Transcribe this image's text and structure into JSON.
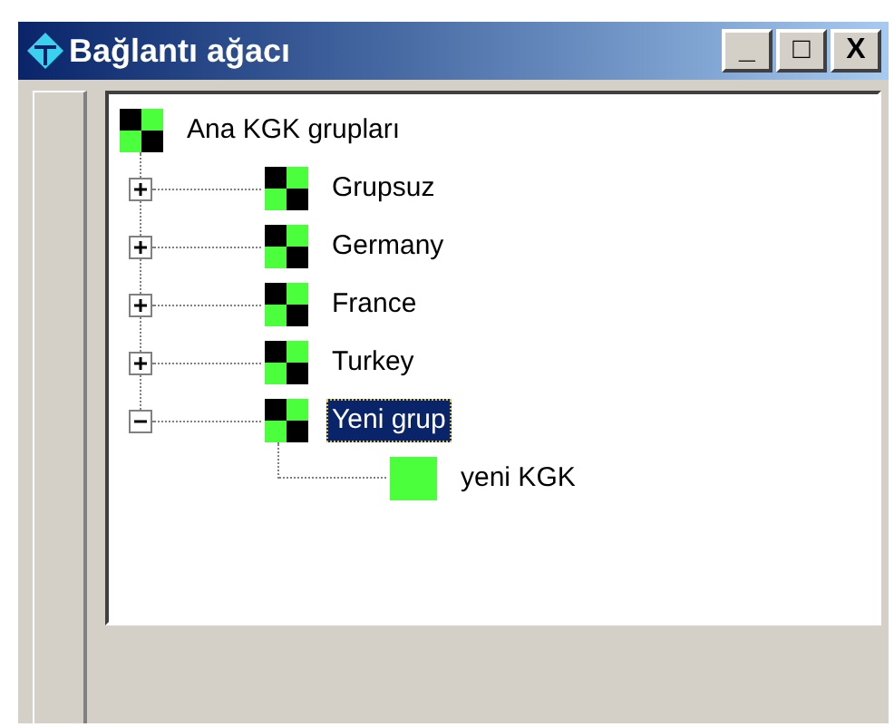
{
  "window": {
    "title": "Bağlantı ağacı",
    "buttons": [
      "_",
      "□",
      "X"
    ]
  },
  "tree": {
    "label": "Ana KGK grupları",
    "kind": "group",
    "selected": false,
    "children": [
      {
        "label": "Grupsuz",
        "kind": "group",
        "expanded": false,
        "selected": false
      },
      {
        "label": "Germany",
        "kind": "group",
        "expanded": false,
        "selected": false
      },
      {
        "label": "France",
        "kind": "group",
        "expanded": false,
        "selected": false
      },
      {
        "label": "Turkey",
        "kind": "group",
        "expanded": false,
        "selected": false
      },
      {
        "label": "Yeni grup",
        "kind": "group",
        "expanded": true,
        "selected": true,
        "children": [
          {
            "label": "yeni KGK",
            "kind": "item",
            "selected": false
          }
        ]
      }
    ]
  }
}
